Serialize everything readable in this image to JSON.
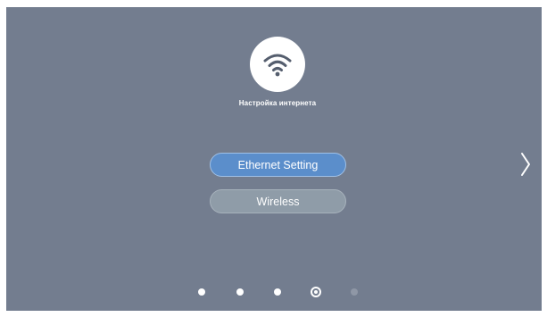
{
  "screen": {
    "title": "Настройка интернета",
    "background_color": "#737d8f"
  },
  "icons": {
    "network": "wifi-icon",
    "next": "chevron-right-icon"
  },
  "buttons": {
    "ethernet_label": "Ethernet Setting",
    "wireless_label": "Wireless"
  },
  "colors": {
    "selected_button": "#5b8ecb",
    "unselected_button": "#8f9ca8"
  },
  "pagination": {
    "total": 5,
    "current": 4
  }
}
